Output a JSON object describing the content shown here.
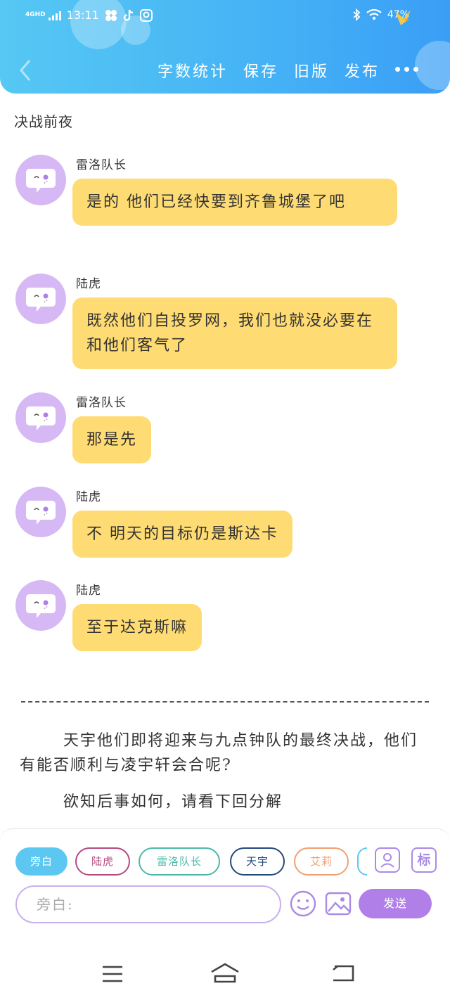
{
  "status_bar": {
    "network": "4GHD",
    "time": "13:11",
    "battery": "47%"
  },
  "toolbar": {
    "items": [
      "字数统计",
      "保存",
      "旧版",
      "发布"
    ]
  },
  "story": {
    "title": "决战前夜",
    "messages": [
      {
        "speaker": "雷洛队长",
        "text": "是的 他们已经快要到齐鲁城堡了吧"
      },
      {
        "speaker": "陆虎",
        "text": "既然他们自投罗网，我们也就没必要在和他们客气了"
      },
      {
        "speaker": "雷洛队长",
        "text": "那是先"
      },
      {
        "speaker": "陆虎",
        "text": "不 明天的目标仍是斯达卡"
      },
      {
        "speaker": "陆虎",
        "text": "至于达克斯嘛"
      }
    ],
    "divider": "——————————————————————————",
    "narration": [
      "天宇他们即将迎来与九点钟队的最终决战，他们有能否顺利与凌宇轩会合呢?",
      "欲知后事如何，请看下回分解"
    ]
  },
  "composer": {
    "roles": [
      "旁白",
      "陆虎",
      "雷洛队长",
      "天宇",
      "艾莉"
    ],
    "label_button": "标",
    "input_placeholder": "旁白:",
    "send_label": "发送"
  },
  "colors": {
    "header": "#46b4f5",
    "bubble": "#ffdc73",
    "avatar": "#d6b9f4",
    "accent_purple": "#b17fe8",
    "role_active": "#5cc8f2"
  }
}
